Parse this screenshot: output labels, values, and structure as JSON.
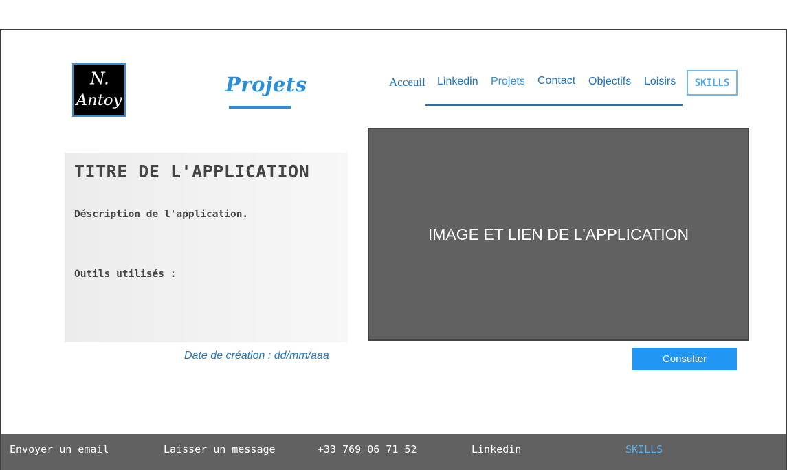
{
  "logo": {
    "text_line1": "N.",
    "text_line2": "Antoy"
  },
  "page_title": "Projets",
  "nav": {
    "items": [
      {
        "label": "Acceuil"
      },
      {
        "label": "Linkedin"
      },
      {
        "label": "Projets"
      },
      {
        "label": "Contact"
      },
      {
        "label": "Objectifs"
      },
      {
        "label": "Loisirs"
      }
    ],
    "skills_label": "SKILLS"
  },
  "project": {
    "title": "TITRE DE L'APPLICATION",
    "description": "Déscription de l'application.",
    "tools_label": "Outils utilisés :",
    "date": "Date de création : dd/mm/aaa",
    "image_label": "IMAGE ET LIEN DE L'APPLICATION",
    "consult_label": "Consulter"
  },
  "footer": {
    "items": [
      {
        "label": "Envoyer un email"
      },
      {
        "label": "Laisser un message"
      },
      {
        "label": "+33 769 06 71 52"
      },
      {
        "label": "Linkedin"
      },
      {
        "label": "SKILLS"
      }
    ]
  },
  "colors": {
    "accent": "#2a8fd6",
    "nav_link": "#1f75c4",
    "button": "#2196f3",
    "image_bg": "#616161",
    "footer_bg": "#616161"
  }
}
